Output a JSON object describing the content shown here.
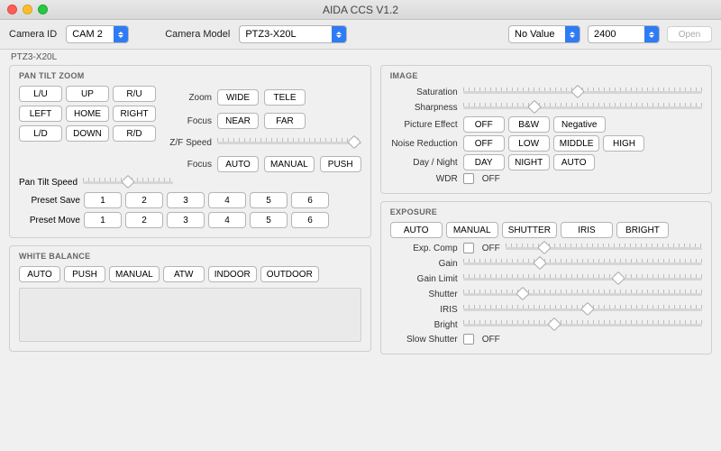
{
  "window": {
    "title": "AIDA CCS V1.2"
  },
  "toolbar": {
    "camera_id_label": "Camera ID",
    "camera_id_value": "CAM 2",
    "camera_model_label": "Camera Model",
    "camera_model_value": "PTZ3-X20L",
    "novalue": "No Value",
    "baud": "2400",
    "open": "Open"
  },
  "subheader": "PTZ3-X20L",
  "ptz": {
    "title": "PAN TILT ZOOM",
    "grid": [
      "L/U",
      "UP",
      "R/U",
      "LEFT",
      "HOME",
      "RIGHT",
      "L/D",
      "DOWN",
      "R/D"
    ],
    "zoom_label": "Zoom",
    "zoom_wide": "WIDE",
    "zoom_tele": "TELE",
    "focus_label": "Focus",
    "focus_near": "NEAR",
    "focus_far": "FAR",
    "zf_speed_label": "Z/F Speed",
    "focus2_label": "Focus",
    "focus_auto": "AUTO",
    "focus_manual": "MANUAL",
    "focus_push": "PUSH",
    "pt_speed_label": "Pan Tilt Speed",
    "preset_save": "Preset Save",
    "preset_move": "Preset Move",
    "presets": [
      "1",
      "2",
      "3",
      "4",
      "5",
      "6"
    ]
  },
  "wb": {
    "title": "WHITE BALANCE",
    "buttons": [
      "AUTO",
      "PUSH",
      "MANUAL",
      "ATW",
      "INDOOR",
      "OUTDOOR"
    ]
  },
  "img": {
    "title": "IMAGE",
    "saturation": "Saturation",
    "sharpness": "Sharpness",
    "picture_effect": "Picture Effect",
    "pe": [
      "OFF",
      "B&W",
      "Negative"
    ],
    "noise": "Noise Reduction",
    "nr": [
      "OFF",
      "LOW",
      "MIDDLE",
      "HIGH"
    ],
    "daynight": "Day / Night",
    "dn": [
      "DAY",
      "NIGHT",
      "AUTO"
    ],
    "wdr": "WDR",
    "off": "OFF"
  },
  "exposure": {
    "title": "EXPOSURE",
    "tabs": [
      "AUTO",
      "MANUAL",
      "SHUTTER",
      "IRIS",
      "BRIGHT"
    ],
    "expcomp": "Exp. Comp",
    "gain": "Gain",
    "gainlimit": "Gain Limit",
    "shutter": "Shutter",
    "iris": "IRIS",
    "bright": "Bright",
    "slowshutter": "Slow Shutter",
    "off": "OFF"
  },
  "sliders": {
    "zf_speed": 95,
    "pt_speed": 50,
    "saturation": 48,
    "sharpness": 30,
    "expcomp": 20,
    "gain": 32,
    "gainlimit": 65,
    "shutter": 25,
    "iris": 52,
    "bright": 38
  }
}
